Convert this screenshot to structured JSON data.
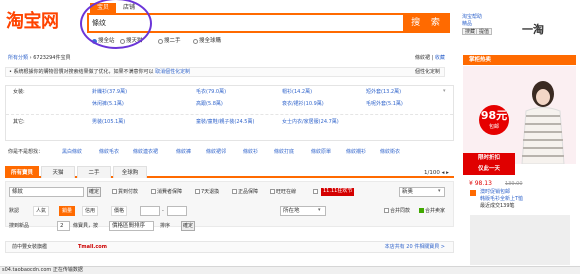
{
  "header": {
    "logo": "淘宝网",
    "search_tabs": [
      "宝贝",
      "店铺"
    ],
    "search_value": "條纹",
    "search_button": "搜 索",
    "radio_options": [
      "搜全站",
      "搜天猫",
      "搜二手",
      "搜全球購"
    ],
    "help_links": [
      "淘宝帮助",
      "精品"
    ],
    "help_buttons": [
      "搜藏",
      "提值"
    ],
    "brand_mark": "一淘"
  },
  "crumbs": {
    "category": "所有分類",
    "count": "6723294件宝貝",
    "keyword": "條紋裙",
    "separator": "|",
    "collect": "收藏"
  },
  "notice": {
    "text": "系統根據你的購物習慣对搜索结果做了优化，如果不满意你可以",
    "link": "取消個性化定制",
    "right": "個性化定制"
  },
  "categories": {
    "女装": [
      "針織衫(37.9萬)",
      "毛衣(79.0萬)",
      "帽衫(14.2萬)",
      "短外套(13.2萬)"
    ],
    "女装2": [
      "休闲裤(5.1萬)",
      "高跟(5.8萬)",
      "衰衣/裙衫(10.9萬)",
      "毛呢外套(5.1萬)"
    ],
    "其它": [
      "男装(105.1萬)",
      "童裝/童鞋/親子装(24.5萬)",
      "女士内衣/家居服(24.7萬)"
    ],
    "labels": [
      "女装:",
      "其它:"
    ]
  },
  "suggestions": {
    "label": "你是不是想找：",
    "items": [
      "黑白條紋",
      "條紋毛衣",
      "條紋連衣裙",
      "條紋褲",
      "條紋裙邻",
      "條紋衫",
      "條紋打底",
      "條紋原單",
      "條紋襯衫",
      "條紋衛衣"
    ]
  },
  "tabs": [
    "所有寶貝",
    "天猫",
    "二手",
    "全球购"
  ],
  "pager": "1/100",
  "filters": {
    "search_value": "條紋",
    "confirm": "確定",
    "checks": [
      "貨到付款",
      "消費者保障",
      "7天退換",
      "正品保障",
      "旺旺在線"
    ],
    "promo_tag": "11.11狂欢节",
    "sort_select": "新奥",
    "sort_label": "默認",
    "sorts": [
      "人氣",
      "銷量",
      "信用",
      "價格"
    ],
    "price_sep": "-",
    "location": "所在地",
    "merge_label": "合并同款",
    "tmall_label": "合并卖家",
    "result_label": "搜到新品",
    "result_value": "2",
    "result_mid": "條寶貝，按",
    "result_sort": "價格區間排序",
    "result_sort_btn": "確定",
    "result_ctrl": "排序"
  },
  "tmall_strip": {
    "left": "前中豐女裝旗艦",
    "brand": "Tmall.com",
    "right": "本店共有 20 件相關寶貝 >"
  },
  "status_bar": "s04.taobaocdn.com 正在传输数据",
  "right_panel": {
    "title": "掌柜热卖",
    "badge_big": "98元",
    "badge_small": "包邮",
    "promo_line1": "限时折扣",
    "promo_line2": "仅此一天",
    "price": "¥ 98.13",
    "orig": "139.00",
    "line1": "澳时促销包邮",
    "line2": "韩版毛衫全新上T恤",
    "line3": "最近成交139笔"
  }
}
